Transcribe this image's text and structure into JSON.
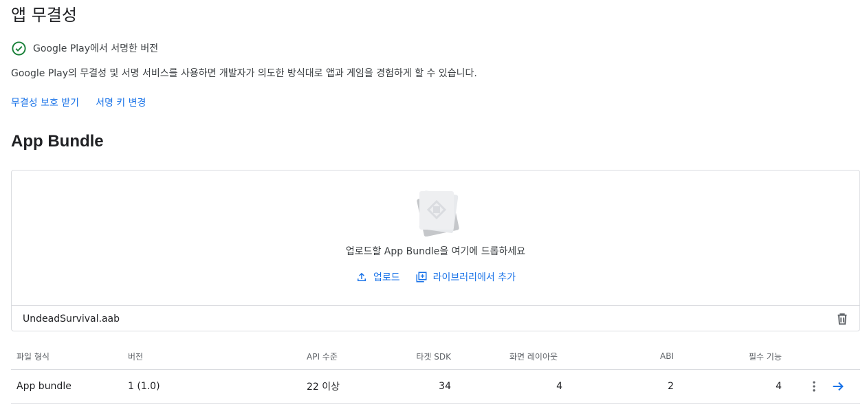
{
  "page_title": "앱 무결성",
  "status": {
    "icon": "check-circle-icon",
    "text": "Google Play에서 서명한 버전",
    "color": "#188038"
  },
  "description": "Google Play의 무결성 및 서명 서비스를 사용하면 개발자가 의도한 방식대로 앱과 게임을 경험하게 할 수 있습니다.",
  "links": {
    "protection": "무결성 보호 받기",
    "signing_key": "서명 키 변경"
  },
  "section_title": "App Bundle",
  "upload": {
    "drop_text": "업로드할 App Bundle을 여기에 드롭하세요",
    "upload_label": "업로드",
    "library_label": "라이브러리에서 추가",
    "file_name": "UndeadSurvival.aab"
  },
  "table": {
    "headers": {
      "format": "파일 형식",
      "version": "버전",
      "api": "API 수준",
      "target_sdk": "타겟 SDK",
      "layouts": "화면 레이아웃",
      "abi": "ABI",
      "features": "필수 기능"
    },
    "row": {
      "format": "App bundle",
      "version": "1 (1.0)",
      "api": "22 이상",
      "target_sdk": "34",
      "layouts": "4",
      "abi": "2",
      "features": "4"
    }
  },
  "colors": {
    "accent": "#1a73e8",
    "divider": "#dadce0"
  }
}
